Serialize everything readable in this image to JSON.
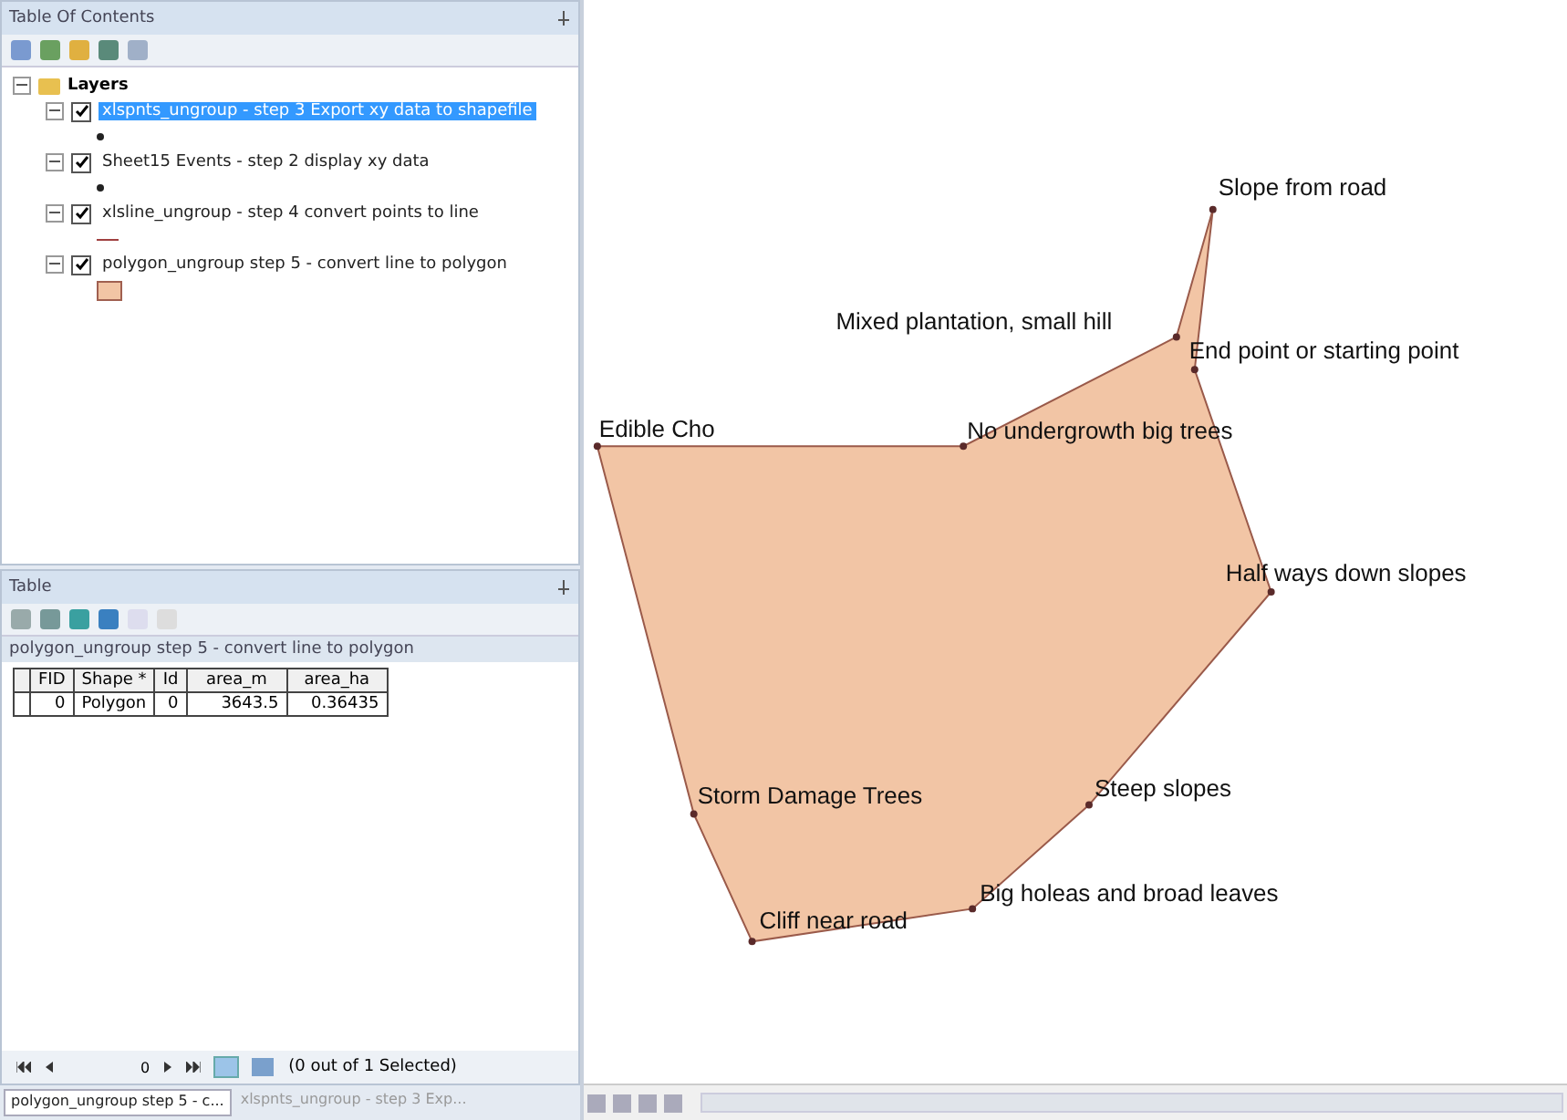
{
  "toc": {
    "title": "Table Of Contents",
    "group": "Layers",
    "expanded": true,
    "layers": [
      {
        "label": "xlspnts_ungroup - step 3 Export xy data to shapefile",
        "checked": true,
        "selected": true,
        "kind": "point"
      },
      {
        "label": "Sheet15 Events - step 2 display xy data",
        "checked": true,
        "selected": false,
        "kind": "point"
      },
      {
        "label": "xlsline_ungroup - step 4 convert points to line",
        "checked": true,
        "selected": false,
        "kind": "line"
      },
      {
        "label": "polygon_ungroup step 5 - convert line to polygon",
        "checked": true,
        "selected": false,
        "kind": "polygon"
      }
    ]
  },
  "table": {
    "title": "Table",
    "layer_tab": "polygon_ungroup step 5 - convert line to polygon",
    "columns": [
      "FID",
      "Shape *",
      "Id",
      "area_m",
      "area_ha"
    ],
    "rows": [
      [
        "0",
        "Polygon",
        "0",
        "3643.5",
        "0.36435"
      ]
    ],
    "record": "0",
    "status": "(0 out of 1 Selected)"
  },
  "bottom_tabs": [
    {
      "label": "polygon_ungroup step 5 - c...",
      "selected": true
    },
    {
      "label": "xlspnts_ungroup - step 3 Exp...",
      "selected": false
    }
  ],
  "map": {
    "points": [
      {
        "label": "Edible Cho"
      },
      {
        "label": "No undergrowth big trees"
      },
      {
        "label": "Mixed plantation, small hill"
      },
      {
        "label": "Slope from road"
      },
      {
        "label": "End point or starting point"
      },
      {
        "label": "Half ways down slopes"
      },
      {
        "label": "Steep slopes"
      },
      {
        "label": "Big holeas and broad leaves"
      },
      {
        "label": "Cliff near road"
      },
      {
        "label": "Storm Damage Trees"
      }
    ]
  }
}
